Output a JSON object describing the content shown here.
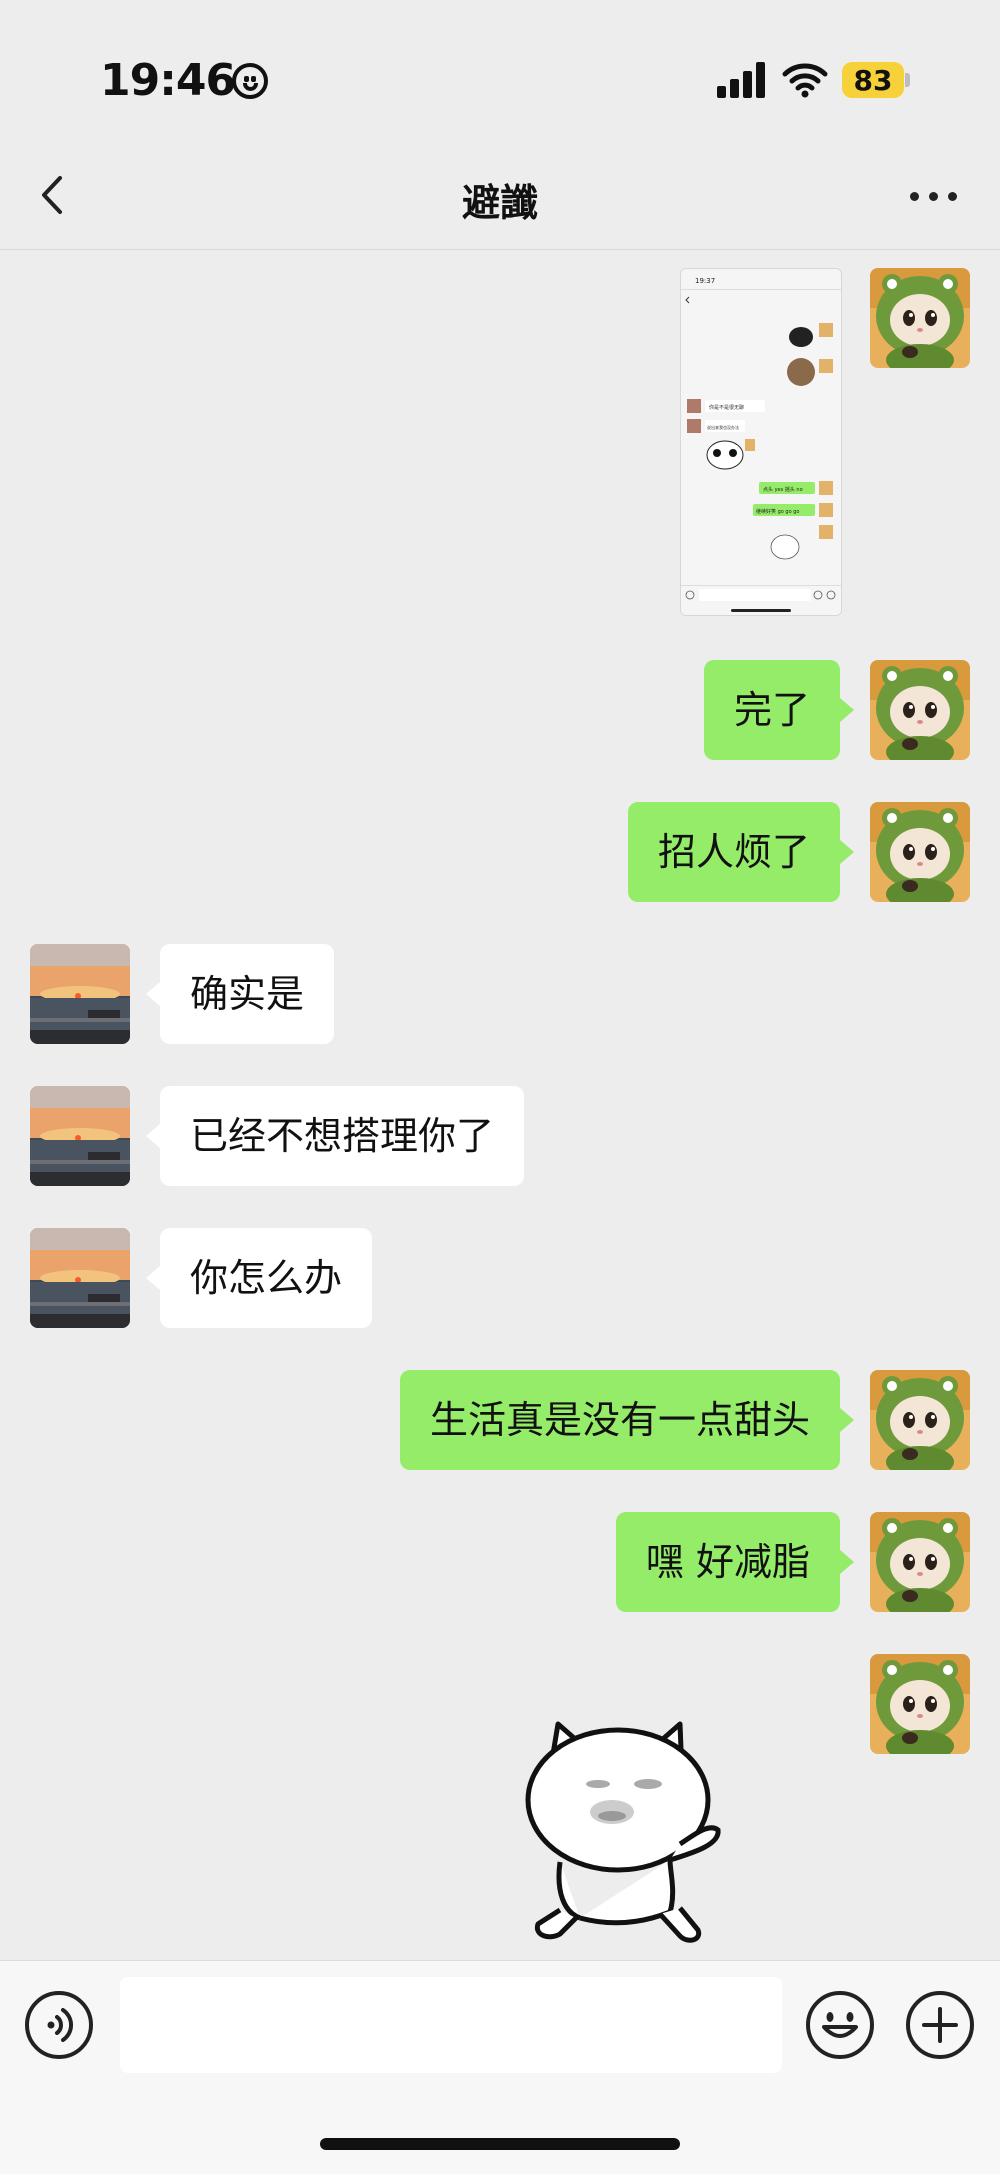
{
  "status_bar": {
    "time": "19:46",
    "battery": "83"
  },
  "nav": {
    "title": "避讖",
    "back_icon": "chevron-left-icon",
    "more_icon": "ellipsis-icon"
  },
  "screenshot_preview": {
    "time": "19:37",
    "messages": [
      "你是不是很无聊",
      "说出来我也没办法",
      "点头 yes 摇头 no",
      "继续好笑 go go go"
    ]
  },
  "messages": [
    {
      "side": "me",
      "text": "完了"
    },
    {
      "side": "me",
      "text": "招人烦了"
    },
    {
      "side": "them",
      "text": "确实是"
    },
    {
      "side": "them",
      "text": "已经不想搭理你了"
    },
    {
      "side": "them",
      "text": "你怎么办"
    },
    {
      "side": "me",
      "text": "生活真是没有一点甜头"
    },
    {
      "side": "me",
      "text": "嘿 好减脂"
    }
  ],
  "input_bar": {
    "placeholder": "",
    "voice_icon": "voice-icon",
    "emoji_icon": "emoji-icon",
    "plus_icon": "plus-icon"
  },
  "colors": {
    "background": "#ededed",
    "my_bubble": "#95ec69",
    "their_bubble": "#ffffff",
    "battery": "#f7d13a"
  }
}
